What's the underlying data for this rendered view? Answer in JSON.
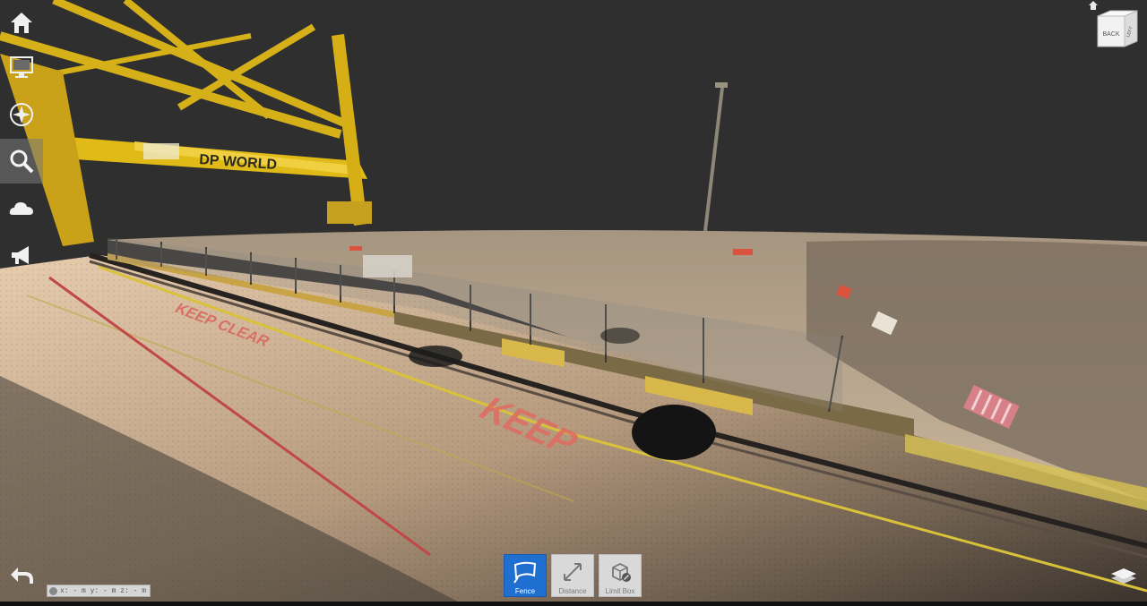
{
  "scene": {
    "crane_signage": "DP WORLD",
    "ground_marking_far": "KEEP CLEAR",
    "ground_marking_near": "KEEP"
  },
  "left_toolbar": {
    "items": [
      {
        "name": "home",
        "icon": "home-icon"
      },
      {
        "name": "display",
        "icon": "monitor-icon"
      },
      {
        "name": "navigation",
        "icon": "compass-icon"
      },
      {
        "name": "search",
        "icon": "search-icon",
        "active": true
      },
      {
        "name": "cloud",
        "icon": "cloud-icon"
      },
      {
        "name": "announce",
        "icon": "megaphone-icon"
      }
    ],
    "back_icon": "back-arrow-icon"
  },
  "view_cube": {
    "front_label": "BACK",
    "side_label": "LEFT"
  },
  "bottom_tools": [
    {
      "label": "Fence",
      "icon": "fence-icon",
      "active": true
    },
    {
      "label": "Distance",
      "icon": "distance-icon",
      "active": false
    },
    {
      "label": "Limit Box",
      "icon": "limit-box-icon",
      "active": false
    }
  ],
  "coordinates": {
    "text": "x: - m y: - m z: - m"
  },
  "colors": {
    "background": "#2f2f2f",
    "crane": "#e8c21a",
    "active_tool": "#1f6fd1",
    "keep_clear": "#e05a5a"
  }
}
